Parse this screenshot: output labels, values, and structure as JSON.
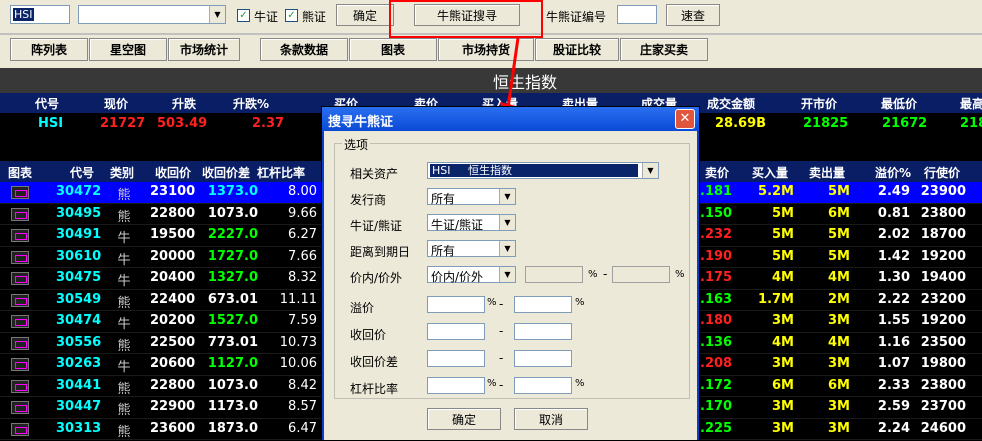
{
  "toolbar": {
    "symbol_value": "HSI",
    "bull_label": "牛证",
    "bear_label": "熊证",
    "confirm_label": "确定",
    "search_label": "牛熊证搜寻",
    "code_label": "牛熊证编号",
    "quick_label": "速查"
  },
  "tabs": [
    "阵列表",
    "星空图",
    "市场统计",
    "条款数据",
    "图表",
    "市场持货",
    "股证比较",
    "庄家买卖"
  ],
  "index_title": "恒生指数",
  "index_header": [
    "代号",
    "现价",
    "升跌",
    "升跌%",
    "买价",
    "卖价",
    "买入量",
    "卖出量",
    "成交量",
    "成交金额",
    "开市价",
    "最低价",
    "最高"
  ],
  "index_row": {
    "code": "HSI",
    "price": "21727",
    "change": "503.49",
    "change_pct": "2.37",
    "turnover": "28.69B",
    "open": "21825",
    "low": "21672",
    "high": "218"
  },
  "table_header": [
    "图表",
    "代号",
    "类别",
    "收回价",
    "收回价差",
    "杠杆比率",
    "卖价",
    "买入量",
    "卖出量",
    "溢价%",
    "行使价"
  ],
  "rows": [
    {
      "code": "30472",
      "type": "熊",
      "recall": "23100",
      "diff": "1373.0",
      "lev": "8.00",
      "price": ".181",
      "bq": "5.2M",
      "sq": "5M",
      "prem": "2.49",
      "strike": "23900",
      "sel": true
    },
    {
      "code": "30495",
      "type": "熊",
      "recall": "22800",
      "diff": "1073.0",
      "lev": "9.66",
      "price": ".150",
      "bq": "5M",
      "sq": "6M",
      "prem": "0.81",
      "strike": "23800"
    },
    {
      "code": "30491",
      "type": "牛",
      "recall": "19500",
      "diff": "2227.0",
      "lev": "6.27",
      "price": ".232",
      "bq": "5M",
      "sq": "5M",
      "prem": "2.02",
      "strike": "18700"
    },
    {
      "code": "30610",
      "type": "牛",
      "recall": "20000",
      "diff": "1727.0",
      "lev": "7.66",
      "price": ".190",
      "bq": "5M",
      "sq": "5M",
      "prem": "1.42",
      "strike": "19200"
    },
    {
      "code": "30475",
      "type": "牛",
      "recall": "20400",
      "diff": "1327.0",
      "lev": "8.32",
      "price": ".175",
      "bq": "4M",
      "sq": "4M",
      "prem": "1.30",
      "strike": "19400"
    },
    {
      "code": "30549",
      "type": "熊",
      "recall": "22400",
      "diff": "673.01",
      "lev": "11.11",
      "price": ".163",
      "bq": "1.7M",
      "sq": "2M",
      "prem": "2.22",
      "strike": "23200"
    },
    {
      "code": "30474",
      "type": "牛",
      "recall": "20200",
      "diff": "1527.0",
      "lev": "7.59",
      "price": ".180",
      "bq": "3M",
      "sq": "3M",
      "prem": "1.55",
      "strike": "19200"
    },
    {
      "code": "30556",
      "type": "熊",
      "recall": "22500",
      "diff": "773.01",
      "lev": "10.73",
      "price": ".136",
      "bq": "4M",
      "sq": "4M",
      "prem": "1.16",
      "strike": "23500"
    },
    {
      "code": "30263",
      "type": "牛",
      "recall": "20600",
      "diff": "1127.0",
      "lev": "10.06",
      "price": ".208",
      "bq": "3M",
      "sq": "3M",
      "prem": "1.07",
      "strike": "19800"
    },
    {
      "code": "30441",
      "type": "熊",
      "recall": "22800",
      "diff": "1073.0",
      "lev": "8.42",
      "price": ".172",
      "bq": "6M",
      "sq": "6M",
      "prem": "2.33",
      "strike": "23800"
    },
    {
      "code": "30447",
      "type": "熊",
      "recall": "22900",
      "diff": "1173.0",
      "lev": "8.57",
      "price": ".170",
      "bq": "3M",
      "sq": "3M",
      "prem": "2.59",
      "strike": "23700"
    },
    {
      "code": "30313",
      "type": "熊",
      "recall": "23600",
      "diff": "1873.0",
      "lev": "6.47",
      "price": ".225",
      "bq": "3M",
      "sq": "3M",
      "prem": "2.24",
      "strike": "24600"
    }
  ],
  "dialog": {
    "title": "搜寻牛熊证",
    "group": "选项",
    "asset_label": "相关资产",
    "asset_value": "HSI     恒生指数",
    "issuer_label": "发行商",
    "issuer_value": "所有",
    "type_label": "牛证/熊证",
    "type_value": "牛证/熊证",
    "expiry_label": "距离到期日",
    "expiry_value": "所有",
    "moneyness_label": "价内/价外",
    "moneyness_value": "价内/价外",
    "premium_label": "溢价",
    "recall_label": "收回价",
    "recall_diff_label": "收回价差",
    "leverage_label": "杠杆比率",
    "ok_label": "确定",
    "cancel_label": "取消"
  },
  "colors": {
    "up": "#00ff00",
    "down": "#ff2020",
    "highlight": "#ff0000",
    "selected": "#0000ff"
  }
}
